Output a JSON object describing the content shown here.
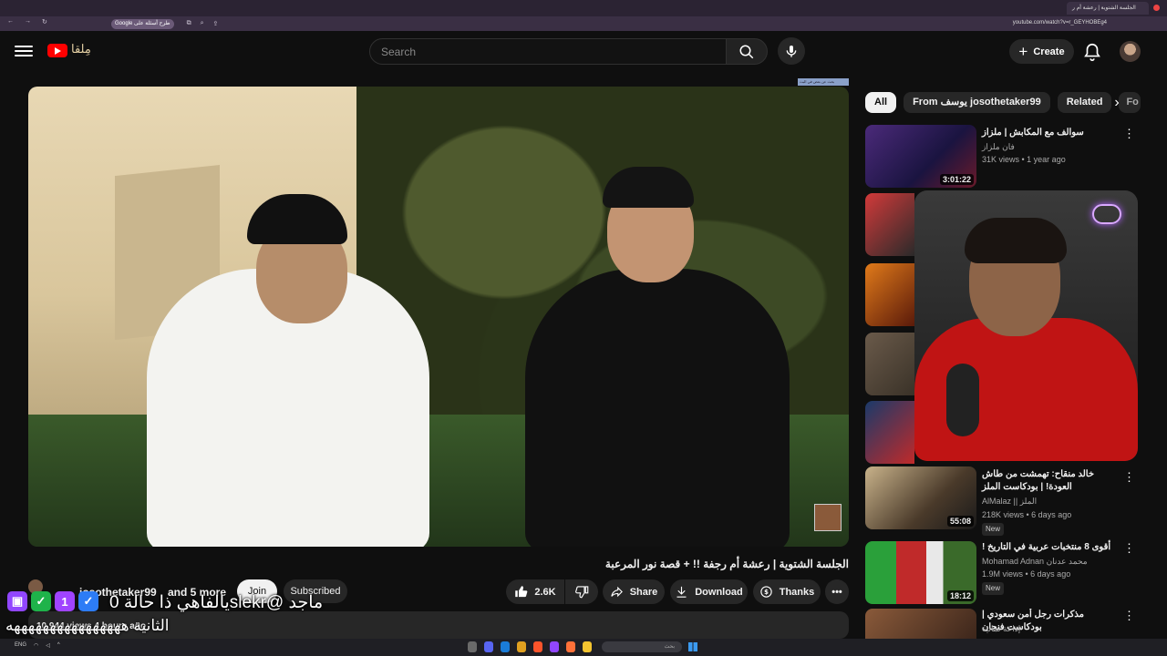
{
  "browser": {
    "tab_title": "الجلسة الشتوية | رعشة أم ر",
    "bookmark_chip": "Google طرح أسئلة على",
    "url": "youtube.com/watch?v=r_GEYHOBEg4"
  },
  "header": {
    "logo_text": "مِلقا",
    "search_placeholder": "Search",
    "create_label": "Create"
  },
  "player": {
    "top_chip": "بحث عن بعض في البث"
  },
  "video": {
    "title": "الجلسة الشتوية | رعشة أم رجفة !! + قصة نور المرعبة",
    "channel": "josothetaker99",
    "and_more": "and 5 more",
    "join": "Join",
    "subscribed": "Subscribed",
    "likes": "2.6K",
    "share": "Share",
    "download": "Download",
    "thanks": "Thanks",
    "views": "10,944 views  4 hours ago"
  },
  "overlay": {
    "line1": "يالفاهي ذا حالة 0slekr@ ماجد",
    "line2": "الثانية ههههههههههههههههه"
  },
  "sidebar": {
    "chips": [
      "All",
      "From يوسف josothetaker99",
      "Related",
      "Fo"
    ],
    "recs": [
      {
        "title": "سوالف مع المكابش | ملزاز",
        "channel": "فان ملزاز",
        "meta": "31K views • 1 year ago",
        "duration": "3:01:22"
      },
      {
        "title": "خالد منقاح: تهمشت من طاش العودة! | بودكاست الملز",
        "channel": "AlMalaz || الملز",
        "meta": "218K views • 6 days ago",
        "duration": "55:08",
        "badge": "New"
      },
      {
        "title": "أقوى 8 منتخبات عربية في التاريخ !",
        "channel": "Mohamad Adnan محمد عدنان",
        "meta": "1.9M views • 6 days ago",
        "duration": "18:12",
        "badge": "New"
      },
      {
        "title": "مذكرات رجل أمن سعودي | بودكاست فنجان",
        "channel": "إذاعة ثمانية"
      }
    ]
  },
  "taskbar": {
    "lang": "ENG",
    "search": "بحث"
  },
  "colors": {
    "accent_red": "#ff0000",
    "background": "#0f0f0f",
    "surface": "#272727"
  }
}
